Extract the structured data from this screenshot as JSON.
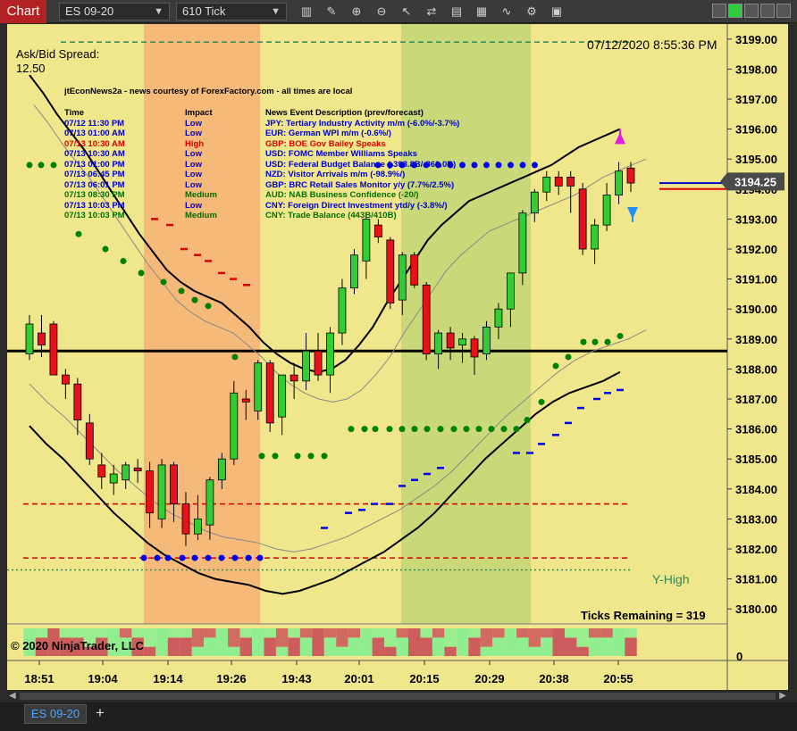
{
  "toolbar": {
    "chart_label": "Chart",
    "instrument": "ES 09-20",
    "interval": "610 Tick",
    "icons": [
      "bar-type-icon",
      "draw-icon",
      "zoom-in-icon",
      "zoom-out-icon",
      "pointer-icon",
      "strategy-icon",
      "data-box-icon",
      "indicators-icon",
      "properties-icon",
      "template-icon"
    ]
  },
  "chart": {
    "spread_label": "Ask/Bid Spread:",
    "spread_value": "12.50",
    "datetime": "07/12/2020 8:55:36 PM",
    "news_title": "jtEconNews2a - news courtesy of ForexFactory.com - all times are local",
    "news_headers": {
      "time": "Time",
      "impact": "Impact",
      "desc": "News Event Description (prev/forecast)"
    },
    "news": [
      {
        "time": "07/12 11:30 PM",
        "impact": "Low",
        "desc": "JPY: Tertiary Industry Activity m/m (-6.0%/-3.7%)",
        "color": "#0000cc"
      },
      {
        "time": "07/13 01:00 AM",
        "impact": "Low",
        "desc": "EUR: German WPI m/m (-0.6%/)",
        "color": "#0000cc"
      },
      {
        "time": "07/13 10:30 AM",
        "impact": "High",
        "desc": "GBP: BOE Gov Bailey Speaks",
        "color": "#dd0000"
      },
      {
        "time": "07/13 10:30 AM",
        "impact": "Low",
        "desc": "USD: FOMC Member Williams Speaks",
        "color": "#0000cc"
      },
      {
        "time": "07/13 01:00 PM",
        "impact": "Low",
        "desc": "USD: Federal Budget Balance (-398.8B/-860.0B)",
        "color": "#0000cc"
      },
      {
        "time": "07/13 06:45 PM",
        "impact": "Low",
        "desc": "NZD: Visitor Arrivals m/m (-98.9%/)",
        "color": "#0000cc"
      },
      {
        "time": "07/13 06:01 PM",
        "impact": "Low",
        "desc": "GBP: BRC Retail Sales Monitor y/y (7.7%/2.5%)",
        "color": "#0000cc"
      },
      {
        "time": "07/13 08:30 PM",
        "impact": "Medium",
        "desc": "AUD: NAB Business Confidence (-20/)",
        "color": "#007000"
      },
      {
        "time": "07/13 10:03 PM",
        "impact": "Low",
        "desc": "CNY: Foreign Direct Investment ytd/y (-3.8%/)",
        "color": "#0000cc"
      },
      {
        "time": "07/13 10:03 PM",
        "impact": "Medium",
        "desc": "CNY: Trade Balance (443B/410B)",
        "color": "#007000"
      }
    ],
    "ticks_remaining": "Ticks Remaining = 319",
    "copyright": "© 2020 NinjaTrader, LLC",
    "y_high_label": "Y-High",
    "current_price": "3194.25",
    "volume_axis_label": "0",
    "colors": {
      "background": "#f0e68c",
      "up": "#32cd32",
      "down": "#e8101a",
      "session_orange": "#f5b97a",
      "session_green": "#c9d97a"
    }
  },
  "chart_data": {
    "type": "candlestick",
    "y_axis": {
      "min": 3179.5,
      "max": 3199.5,
      "ticks": [
        "3199.00",
        "3198.00",
        "3197.00",
        "3196.00",
        "3195.00",
        "3194.00",
        "3193.00",
        "3192.00",
        "3191.00",
        "3190.00",
        "3189.00",
        "3188.00",
        "3187.00",
        "3186.00",
        "3185.00",
        "3184.00",
        "3183.00",
        "3182.00",
        "3181.00",
        "3180.00"
      ]
    },
    "x_axis": {
      "ticks": [
        "18:51",
        "19:04",
        "19:14",
        "19:26",
        "19:43",
        "20:01",
        "20:15",
        "20:29",
        "20:38",
        "20:55"
      ]
    },
    "candles": [
      {
        "o": 3188.5,
        "h": 3189.8,
        "l": 3188.3,
        "c": 3189.5
      },
      {
        "o": 3189.2,
        "h": 3189.8,
        "l": 3188.4,
        "c": 3188.8
      },
      {
        "o": 3189.5,
        "h": 3189.6,
        "l": 3187.8,
        "c": 3187.8
      },
      {
        "o": 3187.8,
        "h": 3188.0,
        "l": 3187.0,
        "c": 3187.5
      },
      {
        "o": 3187.5,
        "h": 3187.7,
        "l": 3185.8,
        "c": 3186.3
      },
      {
        "o": 3186.2,
        "h": 3186.5,
        "l": 3184.8,
        "c": 3185.0
      },
      {
        "o": 3184.8,
        "h": 3185.2,
        "l": 3184.0,
        "c": 3184.4
      },
      {
        "o": 3184.2,
        "h": 3184.8,
        "l": 3183.8,
        "c": 3184.5
      },
      {
        "o": 3184.3,
        "h": 3184.9,
        "l": 3184.0,
        "c": 3184.8
      },
      {
        "o": 3184.7,
        "h": 3185.0,
        "l": 3184.2,
        "c": 3184.6
      },
      {
        "o": 3184.6,
        "h": 3184.9,
        "l": 3182.7,
        "c": 3183.2
      },
      {
        "o": 3183.0,
        "h": 3185.0,
        "l": 3182.7,
        "c": 3184.8
      },
      {
        "o": 3184.8,
        "h": 3184.9,
        "l": 3182.9,
        "c": 3183.5
      },
      {
        "o": 3183.5,
        "h": 3183.9,
        "l": 3182.1,
        "c": 3182.5
      },
      {
        "o": 3182.5,
        "h": 3183.8,
        "l": 3182.3,
        "c": 3183.0
      },
      {
        "o": 3182.8,
        "h": 3184.4,
        "l": 3182.3,
        "c": 3184.3
      },
      {
        "o": 3184.3,
        "h": 3185.2,
        "l": 3184.0,
        "c": 3185.0
      },
      {
        "o": 3185.0,
        "h": 3187.6,
        "l": 3184.8,
        "c": 3187.2
      },
      {
        "o": 3187.0,
        "h": 3187.3,
        "l": 3186.3,
        "c": 3186.9
      },
      {
        "o": 3186.6,
        "h": 3188.3,
        "l": 3186.3,
        "c": 3188.2
      },
      {
        "o": 3188.2,
        "h": 3188.3,
        "l": 3185.9,
        "c": 3186.2
      },
      {
        "o": 3186.4,
        "h": 3187.8,
        "l": 3185.8,
        "c": 3187.8
      },
      {
        "o": 3187.8,
        "h": 3188.2,
        "l": 3187.0,
        "c": 3187.6
      },
      {
        "o": 3187.6,
        "h": 3189.2,
        "l": 3187.3,
        "c": 3188.6
      },
      {
        "o": 3188.6,
        "h": 3189.2,
        "l": 3187.6,
        "c": 3187.8
      },
      {
        "o": 3187.8,
        "h": 3189.4,
        "l": 3187.2,
        "c": 3189.2
      },
      {
        "o": 3189.2,
        "h": 3191.0,
        "l": 3188.8,
        "c": 3190.7
      },
      {
        "o": 3190.7,
        "h": 3192.0,
        "l": 3190.5,
        "c": 3191.8
      },
      {
        "o": 3191.6,
        "h": 3193.2,
        "l": 3191.0,
        "c": 3193.0
      },
      {
        "o": 3192.8,
        "h": 3193.0,
        "l": 3192.2,
        "c": 3192.4
      },
      {
        "o": 3192.3,
        "h": 3192.4,
        "l": 3190.0,
        "c": 3190.2
      },
      {
        "o": 3190.3,
        "h": 3191.9,
        "l": 3189.8,
        "c": 3191.8
      },
      {
        "o": 3191.8,
        "h": 3191.9,
        "l": 3190.7,
        "c": 3190.8
      },
      {
        "o": 3190.8,
        "h": 3190.9,
        "l": 3188.3,
        "c": 3188.5
      },
      {
        "o": 3188.5,
        "h": 3189.3,
        "l": 3188.0,
        "c": 3189.2
      },
      {
        "o": 3189.2,
        "h": 3189.4,
        "l": 3188.3,
        "c": 3188.7
      },
      {
        "o": 3188.8,
        "h": 3189.2,
        "l": 3188.2,
        "c": 3189.0
      },
      {
        "o": 3189.0,
        "h": 3189.1,
        "l": 3187.8,
        "c": 3188.4
      },
      {
        "o": 3188.5,
        "h": 3189.6,
        "l": 3188.3,
        "c": 3189.4
      },
      {
        "o": 3189.4,
        "h": 3190.2,
        "l": 3189.0,
        "c": 3190.0
      },
      {
        "o": 3190.0,
        "h": 3191.2,
        "l": 3189.4,
        "c": 3191.2
      },
      {
        "o": 3191.2,
        "h": 3193.3,
        "l": 3190.8,
        "c": 3193.2
      },
      {
        "o": 3193.2,
        "h": 3194.0,
        "l": 3192.9,
        "c": 3193.9
      },
      {
        "o": 3193.9,
        "h": 3194.6,
        "l": 3193.6,
        "c": 3194.4
      },
      {
        "o": 3194.4,
        "h": 3194.6,
        "l": 3193.8,
        "c": 3194.1
      },
      {
        "o": 3194.4,
        "h": 3194.6,
        "l": 3193.2,
        "c": 3194.1
      },
      {
        "o": 3194.0,
        "h": 3194.2,
        "l": 3191.8,
        "c": 3192.0
      },
      {
        "o": 3192.0,
        "h": 3193.0,
        "l": 3191.5,
        "c": 3192.8
      },
      {
        "o": 3192.8,
        "h": 3194.2,
        "l": 3192.6,
        "c": 3193.8
      },
      {
        "o": 3193.8,
        "h": 3194.9,
        "l": 3193.5,
        "c": 3194.6
      },
      {
        "o": 3194.7,
        "h": 3194.9,
        "l": 3193.9,
        "c": 3194.2
      }
    ],
    "horizontal_lines": [
      {
        "y": 3198.9,
        "color": "#2e8b57",
        "style": "dashed"
      },
      {
        "y": 3188.6,
        "color": "#000000",
        "style": "solid"
      },
      {
        "y": 3183.5,
        "color": "#e0a000",
        "style": "dashed"
      },
      {
        "y": 3183.5,
        "color": "#dd0000",
        "style": "dashed"
      },
      {
        "y": 3181.7,
        "color": "#dd0000",
        "style": "dashed"
      },
      {
        "y": 3181.3,
        "color": "#2e8b57",
        "style": "dotted"
      },
      {
        "y": 3194.2,
        "color": "#0000cc",
        "style": "solid"
      },
      {
        "y": 3194.0,
        "color": "#dd0000",
        "style": "solid"
      }
    ],
    "volume": [
      3,
      2,
      3,
      2,
      2,
      1,
      2,
      3,
      2,
      2,
      1,
      3,
      2,
      2,
      1,
      2,
      3,
      1,
      2,
      3,
      2,
      1,
      2,
      2,
      3,
      2,
      1,
      2,
      3,
      2,
      1,
      2,
      3,
      2,
      2,
      1,
      3,
      2,
      1,
      2,
      3,
      2,
      1,
      2,
      3,
      2,
      1,
      2,
      2,
      3,
      2
    ]
  }
}
